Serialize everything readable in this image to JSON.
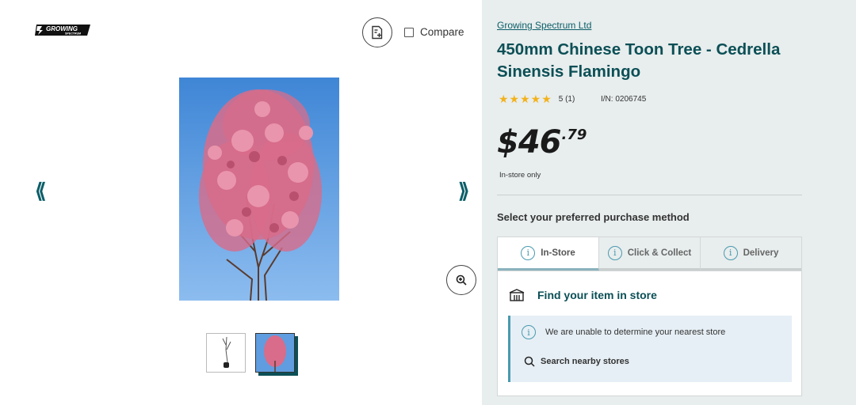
{
  "brand": {
    "logo_name": "Growing Spectrum logo",
    "logo_text": "GROWING",
    "logo_subtext": "SPECTRUM"
  },
  "compare": {
    "label": "Compare",
    "icon": "document-plus-icon"
  },
  "gallery": {
    "prev_label": "⟪",
    "next_label": "⟫",
    "thumbnails": [
      "bare-root seedling",
      "flowering tree"
    ],
    "zoom_icon": "zoom-in-icon"
  },
  "product": {
    "brand_link": "Growing Spectrum Ltd",
    "title": "450mm Chinese Toon Tree - Cedrella Sinensis Flamingo",
    "stars": "★★★★★",
    "rating_summary": "5 (1)",
    "item_number": "I/N: 0206745",
    "price_dollars": "$46",
    "price_cents": ".79",
    "availability_note": "In-store only"
  },
  "purchase": {
    "heading": "Select your preferred purchase method",
    "tabs": [
      {
        "label": "In-Store",
        "active": true
      },
      {
        "label": "Click & Collect",
        "active": false
      },
      {
        "label": "Delivery",
        "active": false
      }
    ],
    "find_title": "Find your item in store",
    "notice_text": "We are unable to determine your nearest store",
    "search_label": "Search nearby stores"
  },
  "colors": {
    "teal": "#0b4f56",
    "accent_blue": "#4a9ab0",
    "star": "#f3b21b",
    "right_bg": "#e8eded"
  }
}
